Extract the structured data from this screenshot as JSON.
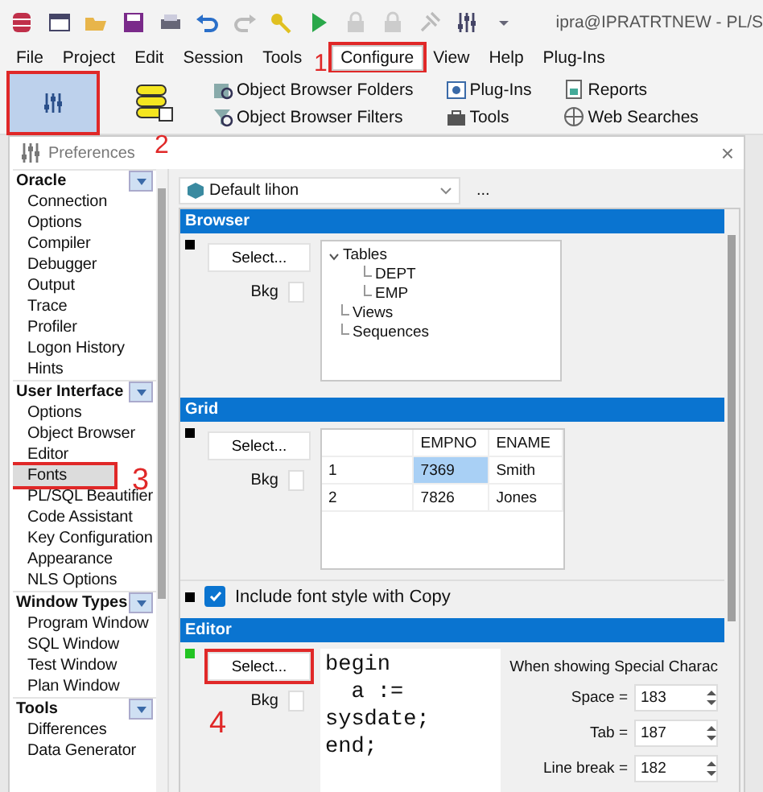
{
  "app": {
    "title": "ipra@IPRATRTNEW - PL/S"
  },
  "menu": [
    {
      "label": "File",
      "selected": false
    },
    {
      "label": "Project",
      "selected": false
    },
    {
      "label": "Edit",
      "selected": false
    },
    {
      "label": "Session",
      "selected": false
    },
    {
      "label": "Tools",
      "selected": false
    },
    {
      "label": "Configure",
      "selected": true
    },
    {
      "label": "View",
      "selected": false
    },
    {
      "label": "Help",
      "selected": false
    },
    {
      "label": "Plug-Ins",
      "selected": false
    }
  ],
  "ribbon": {
    "preferences_selected": true,
    "items": [
      {
        "label": "Object Browser Folders",
        "kind": "folders"
      },
      {
        "label": "Object Browser Filters",
        "kind": "filters"
      },
      {
        "label": "Plug-Ins",
        "kind": "plugins"
      },
      {
        "label": "Tools",
        "kind": "tools"
      },
      {
        "label": "Reports",
        "kind": "reports"
      },
      {
        "label": "Web Searches",
        "kind": "web"
      }
    ]
  },
  "dialog": {
    "title": "Preferences",
    "close": "×"
  },
  "sidebar": [
    {
      "group": "Oracle",
      "items": [
        {
          "label": "Connection",
          "selected": false
        },
        {
          "label": "Options",
          "selected": false
        },
        {
          "label": "Compiler",
          "selected": false
        },
        {
          "label": "Debugger",
          "selected": false
        },
        {
          "label": "Output",
          "selected": false
        },
        {
          "label": "Trace",
          "selected": false
        },
        {
          "label": "Profiler",
          "selected": false
        },
        {
          "label": "Logon History",
          "selected": false
        },
        {
          "label": "Hints",
          "selected": false
        }
      ]
    },
    {
      "group": "User Interface",
      "items": [
        {
          "label": "Options",
          "selected": false
        },
        {
          "label": "Object Browser",
          "selected": false
        },
        {
          "label": "Editor",
          "selected": false
        },
        {
          "label": "Fonts",
          "selected": true
        },
        {
          "label": "PL/SQL Beautifier",
          "selected": false
        },
        {
          "label": "Code Assistant",
          "selected": false
        },
        {
          "label": "Key Configuration",
          "selected": false
        },
        {
          "label": "Appearance",
          "selected": false
        },
        {
          "label": "NLS Options",
          "selected": false
        }
      ]
    },
    {
      "group": "Window Types",
      "items": [
        {
          "label": "Program Window",
          "selected": false
        },
        {
          "label": "SQL Window",
          "selected": false
        },
        {
          "label": "Test Window",
          "selected": false
        },
        {
          "label": "Plan Window",
          "selected": false
        }
      ]
    },
    {
      "group": "Tools",
      "items": [
        {
          "label": "Differences",
          "selected": false
        },
        {
          "label": "Data Generator",
          "selected": false
        }
      ]
    }
  ],
  "profile": {
    "value": "Default lihon",
    "more": "..."
  },
  "browser": {
    "header": "Browser",
    "color": "#000000",
    "select": "Select...",
    "bkg": "Bkg",
    "tree": [
      {
        "label": "Tables",
        "expanded": true,
        "children": [
          {
            "label": "DEPT"
          },
          {
            "label": "EMP"
          }
        ]
      },
      {
        "label": "Views"
      },
      {
        "label": "Sequences"
      }
    ]
  },
  "grid": {
    "header": "Grid",
    "color": "#000000",
    "select": "Select...",
    "bkg": "Bkg",
    "columns": [
      "EMPNO",
      "ENAME"
    ],
    "rows": [
      {
        "number": "1",
        "cells": [
          {
            "text": "7369",
            "selected": true
          },
          {
            "text": "Smith",
            "selected": false
          }
        ]
      },
      {
        "number": "2",
        "cells": [
          {
            "text": "7826",
            "selected": false
          },
          {
            "text": "Jones",
            "selected": false
          }
        ]
      }
    ],
    "include": {
      "color": "#000000",
      "label": "Include font style with Copy",
      "checked": true
    }
  },
  "editor": {
    "header": "Editor",
    "color": "#22c422",
    "select": "Select...",
    "bkg": "Bkg",
    "code": [
      "begin",
      "  a :=",
      "sysdate;",
      "end;"
    ],
    "special": {
      "title": "When showing Special Charac",
      "fields": [
        {
          "label": "Space =",
          "value": "183"
        },
        {
          "label": "Tab =",
          "value": "187"
        },
        {
          "label": "Line break =",
          "value": "182"
        }
      ]
    }
  },
  "annotations": [
    "1",
    "2",
    "3",
    "4"
  ]
}
